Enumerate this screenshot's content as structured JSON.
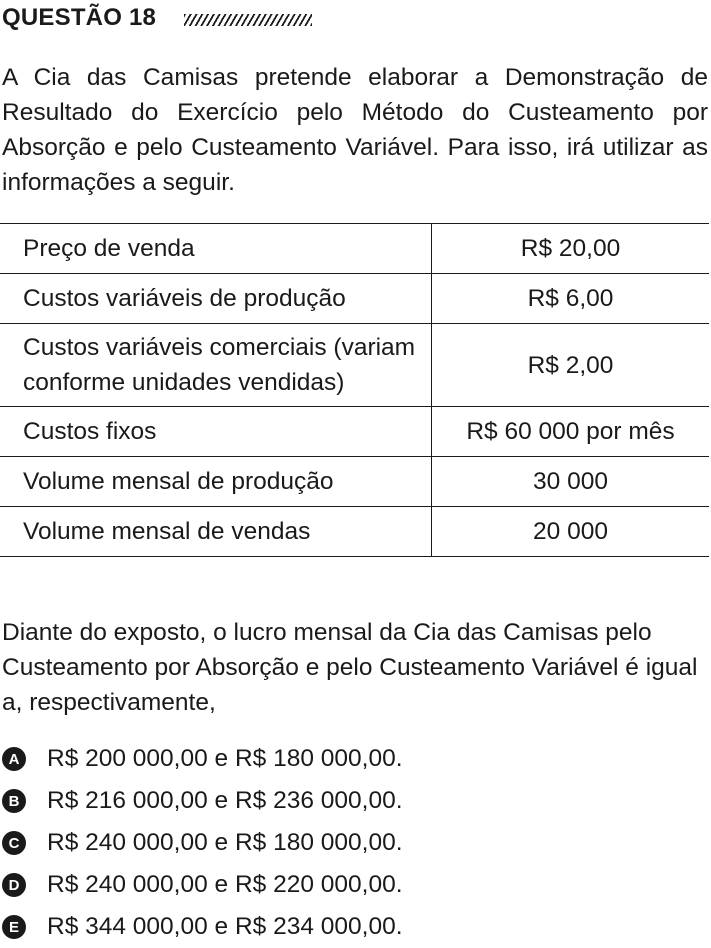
{
  "header": {
    "title": "QUESTÃO 18"
  },
  "intro": "A Cia das Camisas pretende elaborar a Demonstração de Resultado do Exercício pelo Método do Custeamento por Absorção e pelo Custeamento Variável. Para isso, irá utilizar as informações a seguir.",
  "table": {
    "rows": [
      {
        "label": "Preço de venda",
        "value": "R$ 20,00"
      },
      {
        "label": "Custos variáveis de produção",
        "value": "R$ 6,00"
      },
      {
        "label": "Custos variáveis comerciais (variam conforme unidades vendidas)",
        "value": "R$ 2,00"
      },
      {
        "label": "Custos fixos",
        "value": "R$ 60 000 por mês"
      },
      {
        "label": "Volume mensal de produção",
        "value": "30 000"
      },
      {
        "label": "Volume mensal de vendas",
        "value": "20 000"
      }
    ]
  },
  "question": "Diante do exposto, o lucro mensal da Cia das Camisas pelo Custeamento por Absorção e pelo Custeamento Variável é igual a, respectivamente,",
  "options": [
    {
      "letter": "A",
      "text": "R$ 200 000,00 e R$ 180 000,00."
    },
    {
      "letter": "B",
      "text": "R$ 216 000,00 e R$ 236 000,00."
    },
    {
      "letter": "C",
      "text": "R$ 240 000,00 e R$ 180 000,00."
    },
    {
      "letter": "D",
      "text": "R$ 240 000,00 e R$ 220 000,00."
    },
    {
      "letter": "E",
      "text": "R$ 344 000,00 e R$ 234 000,00."
    }
  ]
}
